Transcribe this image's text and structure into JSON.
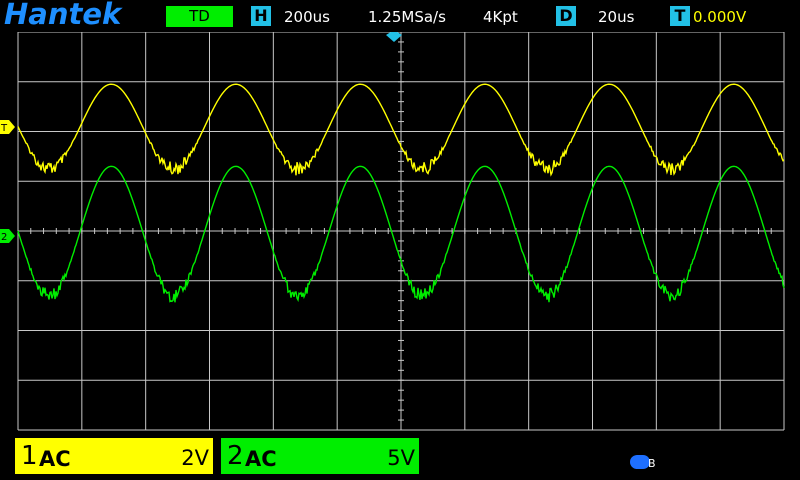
{
  "header": {
    "brand": "Hantek",
    "mode": "TD",
    "horizontal": {
      "icon": "H",
      "timebase": "200us",
      "sample_rate": "1.25MSa/s",
      "memory": "4Kpt"
    },
    "delay": {
      "icon": "D",
      "value": "20us"
    },
    "trigger": {
      "icon": "T",
      "level": "0.000V"
    }
  },
  "markers": {
    "ch1": "1",
    "ch2": "2",
    "trigger": "T"
  },
  "waveforms": [
    {
      "channel": "1",
      "color": "#ffff00",
      "shape": "sine",
      "period_divisions": 1.95,
      "amplitude_divisions": 0.85,
      "offset_divisions": 0.85,
      "noise_band": "upper"
    },
    {
      "channel": "2",
      "color": "#00ee00",
      "shape": "sine",
      "period_divisions": 1.95,
      "amplitude_divisions": 1.3,
      "offset_divisions": 0.0,
      "noise_band": "upper"
    }
  ],
  "channels": [
    {
      "number": "1",
      "coupling": "AC",
      "scale": "2V",
      "color": "#ffff00"
    },
    {
      "number": "2",
      "coupling": "AC",
      "scale": "5V",
      "color": "#00ee00"
    }
  ],
  "status": {
    "usb_icon": "usb-icon",
    "usb_label": "B"
  },
  "colors": {
    "accent": "#22c0e6",
    "brand": "#1e8fff",
    "grid": "#c8c8c8",
    "ch1": "#ffff00",
    "ch2": "#00ee00"
  }
}
